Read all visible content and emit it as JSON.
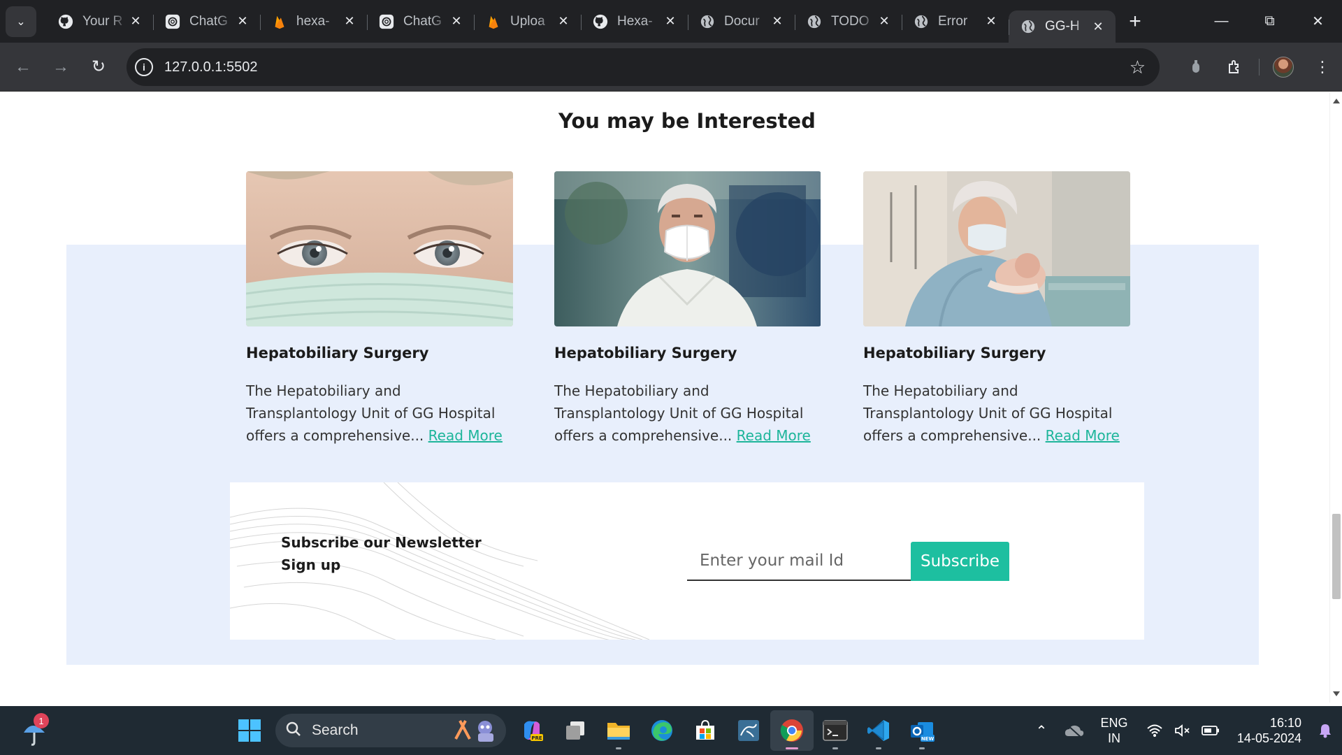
{
  "browser": {
    "tabs": [
      {
        "title": "Your R",
        "favicon": "github-icon",
        "active": false
      },
      {
        "title": "ChatG",
        "favicon": "chatgpt-icon",
        "active": false
      },
      {
        "title": "hexa-",
        "favicon": "firebase-icon",
        "active": false
      },
      {
        "title": "ChatG",
        "favicon": "chatgpt-icon",
        "active": false
      },
      {
        "title": "Uploa",
        "favicon": "firebase-icon",
        "active": false
      },
      {
        "title": "Hexa-",
        "favicon": "github-icon",
        "active": false
      },
      {
        "title": "Docur",
        "favicon": "globe-icon",
        "active": false
      },
      {
        "title": "TODO",
        "favicon": "globe-icon",
        "active": false
      },
      {
        "title": "Error",
        "favicon": "globe-icon",
        "active": false
      },
      {
        "title": "GG-H",
        "favicon": "globe-icon",
        "active": true
      }
    ],
    "url": "127.0.0.1:5502",
    "dark_color": "#202124",
    "toolbar_color": "#35363a"
  },
  "page": {
    "section_title": "You may be Interested",
    "cards": [
      {
        "title": "Hepatobiliary Surgery",
        "text": "The Hepatobiliary and Transplantology Unit of GG Hospital offers a comprehensive...",
        "link": "Read More",
        "image": "masked-nurse-eyes"
      },
      {
        "title": "Hepatobiliary Surgery",
        "text": "The Hepatobiliary and Transplantology Unit of GG Hospital offers a comprehensive...",
        "link": "Read More",
        "image": "elderly-man-with-mask"
      },
      {
        "title": "Hepatobiliary Surgery",
        "text": "The Hepatobiliary and Transplantology Unit of GG Hospital offers a comprehensive...",
        "link": "Read More",
        "image": "surgeon-holding-newborn"
      }
    ],
    "newsletter": {
      "title_line1": "Subscribe our Newsletter",
      "title_line2": "Sign up",
      "input_placeholder": "Enter your mail Id",
      "button_label": "Subscribe"
    },
    "colors": {
      "accent": "#1dbfa0",
      "link": "#1db59a",
      "section_bg": "#e8effc"
    }
  },
  "taskbar": {
    "notification_count": "1",
    "search_label": "Search",
    "apps": [
      "windows-start-icon",
      "copilot-icon",
      "task-view-icon",
      "file-explorer-icon",
      "edge-icon",
      "microsoft-store-icon",
      "mysql-workbench-icon",
      "chrome-icon",
      "terminal-icon",
      "vscode-icon",
      "outlook-new-icon"
    ],
    "active_app": "chrome-icon",
    "language_line1": "ENG",
    "language_line2": "IN",
    "time": "16:10",
    "date": "14-05-2024"
  }
}
